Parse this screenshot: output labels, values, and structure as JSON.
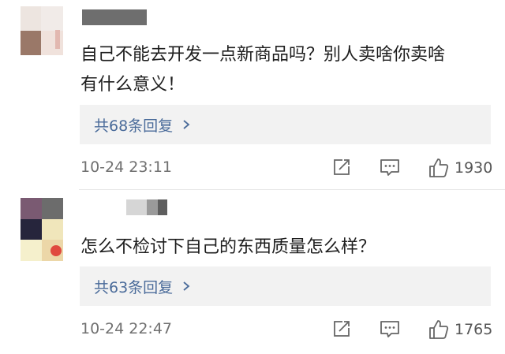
{
  "comments": [
    {
      "text_line1": "自己不能去开发一点新商品吗？别人卖啥你卖啥",
      "text_line2": "有什么意义！",
      "replies": "共68条回复",
      "timestamp": "10-24 23:11",
      "likes": "1930"
    },
    {
      "text_line1": "怎么不检讨下自己的东西质量怎么样？",
      "replies": "共63条回复",
      "timestamp": "10-24 22:47",
      "likes": "1765"
    }
  ],
  "colors": {
    "link": "#4a6b9a",
    "reply_box_bg": "#f2f2f2",
    "meta_text": "#707070",
    "icon": "#666666"
  },
  "icons": [
    "share-icon",
    "comment-icon",
    "like-icon",
    "chevron-right-icon"
  ]
}
